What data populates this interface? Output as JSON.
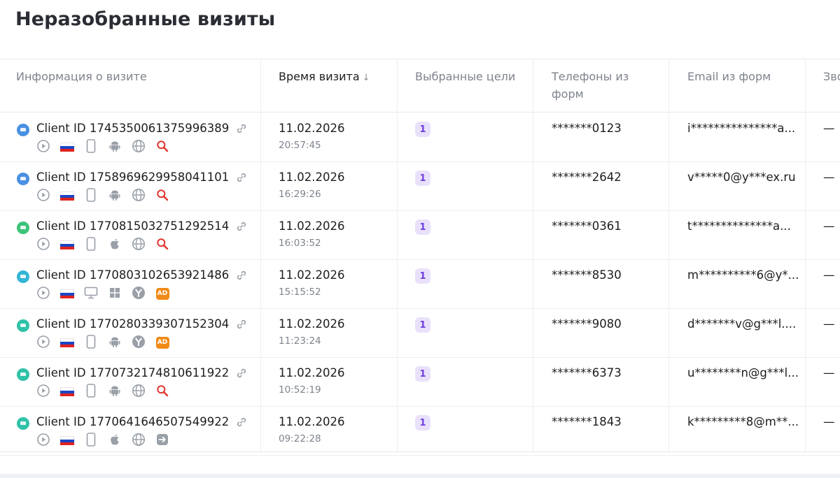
{
  "page": {
    "title": "Неразобранные визиты"
  },
  "table": {
    "headers": {
      "info": "Информация о визите",
      "time": "Время визита",
      "sort_arrow": "↓",
      "goals": "Выбранные цели",
      "phones": "Телефоны из форм",
      "emails": "Email из форм",
      "calls": "Зво"
    },
    "rows": [
      {
        "client_id": "Client ID 1745350061375996389",
        "date": "11.02.2026",
        "time": "20:57:45",
        "goals": "1",
        "phone": "*******0123",
        "email": "i***************a...",
        "calls": "—",
        "avatar_color": "#4a90e2",
        "device": "mobile-phone-icon",
        "os": "android-icon",
        "browser": "globe-icon",
        "source": "search-icon"
      },
      {
        "client_id": "Client ID 1758969629958041101",
        "date": "11.02.2026",
        "time": "16:29:26",
        "goals": "1",
        "phone": "*******2642",
        "email": "v*****0@y***ex.ru",
        "calls": "—",
        "avatar_color": "#4a90e2",
        "device": "mobile-phone-icon",
        "os": "android-icon",
        "browser": "globe-icon",
        "source": "search-icon"
      },
      {
        "client_id": "Client ID 1770815032751292514",
        "date": "11.02.2026",
        "time": "16:03:52",
        "goals": "1",
        "phone": "*******0361",
        "email": "t**************a...",
        "calls": "—",
        "avatar_color": "#3cc47a",
        "device": "mobile-phone-icon",
        "os": "apple-icon",
        "browser": "globe-icon",
        "source": "search-icon"
      },
      {
        "client_id": "Client ID 1770803102653921486",
        "date": "11.02.2026",
        "time": "15:15:52",
        "goals": "1",
        "phone": "*******8530",
        "email": "m**********6@y*...",
        "calls": "—",
        "avatar_color": "#33b5d6",
        "device": "desktop-icon",
        "os": "windows-icon",
        "browser": "yandex-browser-icon",
        "source": "ad-icon"
      },
      {
        "client_id": "Client ID 1770280339307152304",
        "date": "11.02.2026",
        "time": "11:23:24",
        "goals": "1",
        "phone": "*******9080",
        "email": "d*******v@g***l....",
        "calls": "—",
        "avatar_color": "#2fc2a8",
        "device": "mobile-phone-icon",
        "os": "android-icon",
        "browser": "yandex-browser-icon",
        "source": "ad-icon"
      },
      {
        "client_id": "Client ID 1770732174810611922",
        "date": "11.02.2026",
        "time": "10:52:19",
        "goals": "1",
        "phone": "*******6373",
        "email": "u********n@g***l...",
        "calls": "—",
        "avatar_color": "#2fc2a8",
        "device": "mobile-phone-icon",
        "os": "android-icon",
        "browser": "globe-icon",
        "source": "search-icon"
      },
      {
        "client_id": "Client ID 1770641646507549922",
        "date": "11.02.2026",
        "time": "09:22:28",
        "goals": "1",
        "phone": "*******1843",
        "email": "k*********8@m**...",
        "calls": "—",
        "avatar_color": "#2fc2a8",
        "device": "mobile-phone-icon",
        "os": "apple-icon",
        "browser": "globe-icon",
        "source": "direct-entry-icon"
      }
    ]
  },
  "colors": {
    "goal_badge_bg": "#e9e1fb",
    "goal_badge_text": "#6e3fe0",
    "search_icon": "#e0342f",
    "ad_badge": "#f08a16"
  }
}
